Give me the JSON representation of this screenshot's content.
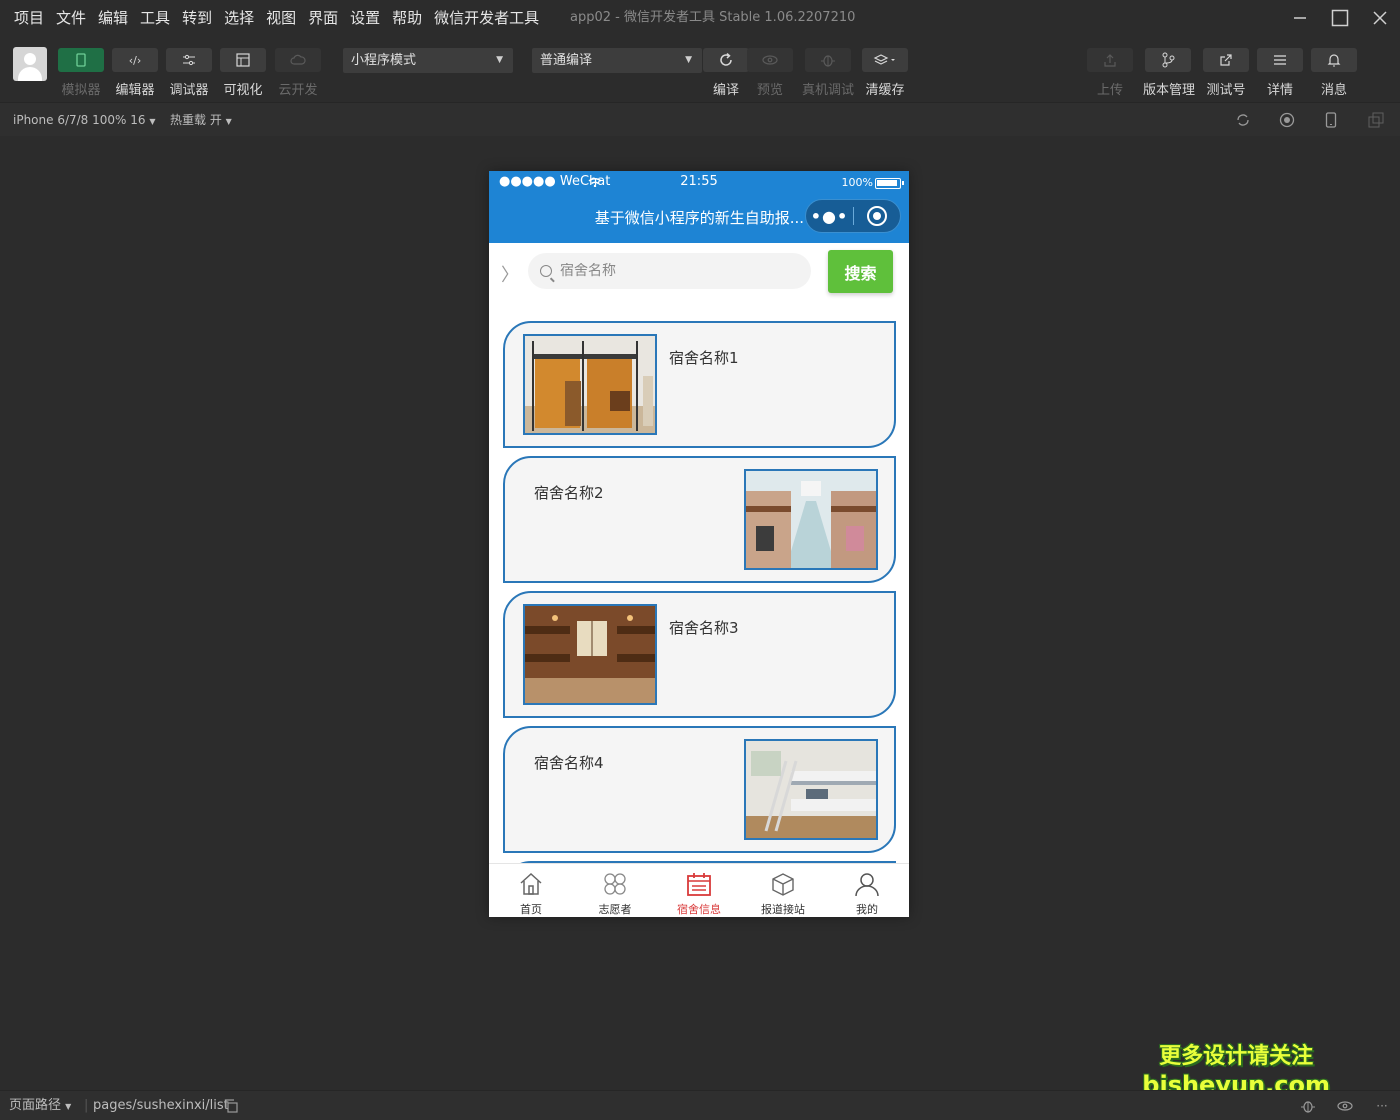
{
  "menu": [
    "项目",
    "文件",
    "编辑",
    "工具",
    "转到",
    "选择",
    "视图",
    "界面",
    "设置",
    "帮助",
    "微信开发者工具"
  ],
  "window": {
    "title": "app02 - 微信开发者工具 Stable 1.06.2207210"
  },
  "toolbar": {
    "simulator": "模拟器",
    "editor": "编辑器",
    "debugger": "调试器",
    "visual": "可视化",
    "cloud": "云开发",
    "mode": "小程序模式",
    "compile_mode": "普通编译",
    "compile": "编译",
    "preview": "预览",
    "real_debug": "真机调试",
    "clear_cache": "清缓存",
    "upload": "上传",
    "version": "版本管理",
    "test_account": "测试号",
    "details": "详情",
    "messages": "消息"
  },
  "subbar": {
    "device": "iPhone 6/7/8 100% 16",
    "hot_reload": "热重载 开"
  },
  "phone": {
    "status": {
      "signal": "●●●●● WeChat",
      "time": "21:55",
      "battery": "100%"
    },
    "nav_title": "基于微信小程序的新生自助报...",
    "search": {
      "placeholder": "宿舍名称",
      "button": "搜索"
    },
    "items": [
      {
        "name": "宿舍名称1"
      },
      {
        "name": "宿舍名称2"
      },
      {
        "name": "宿舍名称3"
      },
      {
        "name": "宿舍名称4"
      }
    ],
    "tabs": [
      {
        "label": "首页",
        "icon": "home-icon"
      },
      {
        "label": "志愿者",
        "icon": "grid-icon"
      },
      {
        "label": "宿舍信息",
        "icon": "calendar-icon",
        "active": true
      },
      {
        "label": "报道接站",
        "icon": "package-icon"
      },
      {
        "label": "我的",
        "icon": "user-icon"
      }
    ]
  },
  "bottom": {
    "path_label": "页面路径",
    "path": "pages/sushexinxi/list"
  },
  "watermark": {
    "line1": "更多设计请关注",
    "line2": "bisheyun.com"
  },
  "colors": {
    "nav_blue": "#1e84d4",
    "card_border": "#2a77b8",
    "search_green": "#5fc03b",
    "tab_active": "#d93a3a"
  }
}
